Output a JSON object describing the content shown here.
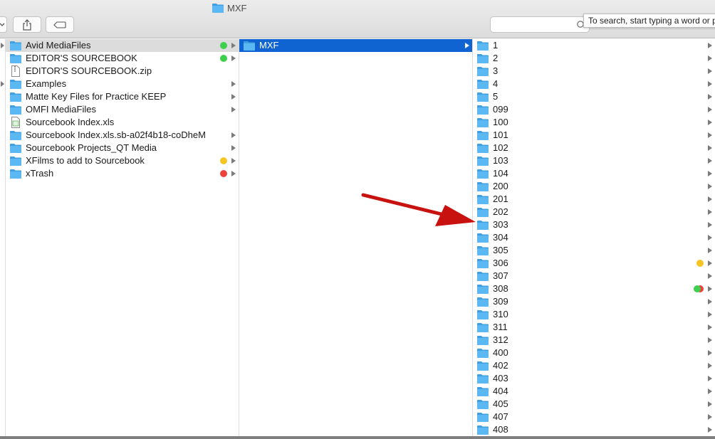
{
  "window": {
    "title": "MXF"
  },
  "toolbar": {
    "share_icon": "share-icon",
    "tag_icon": "tag-icon"
  },
  "search": {
    "placeholder": "",
    "tooltip": "To search, start typing a word or p"
  },
  "column1": {
    "items": [
      {
        "name": "Avid MediaFiles",
        "kind": "folder",
        "tag": "#3fcf4f",
        "arrow": true,
        "selected": "gray"
      },
      {
        "name": "EDITOR'S SOURCEBOOK",
        "kind": "folder",
        "tag": "#3fcf4f",
        "arrow": true
      },
      {
        "name": "EDITOR'S SOURCEBOOK.zip",
        "kind": "zip",
        "arrow": false
      },
      {
        "name": "Examples",
        "kind": "folder",
        "arrow": true
      },
      {
        "name": "Matte Key Files for Practice KEEP",
        "kind": "folder",
        "arrow": true
      },
      {
        "name": "OMFI MediaFiles",
        "kind": "folder",
        "arrow": true
      },
      {
        "name": "Sourcebook Index.xls",
        "kind": "xls",
        "arrow": false
      },
      {
        "name": "Sourcebook Index.xls.sb-a02f4b18-coDheM",
        "kind": "folder",
        "arrow": true
      },
      {
        "name": "Sourcebook Projects_QT Media",
        "kind": "folder",
        "arrow": true
      },
      {
        "name": "XFilms to add to Sourcebook",
        "kind": "folder",
        "tag": "#f5c623",
        "arrow": true
      },
      {
        "name": "xTrash",
        "kind": "folder",
        "tag": "#f0403c",
        "arrow": true
      }
    ]
  },
  "column2": {
    "items": [
      {
        "name": "MXF",
        "kind": "folder",
        "arrow": true,
        "selected": "blue"
      }
    ]
  },
  "column3": {
    "items": [
      {
        "name": "1"
      },
      {
        "name": "2"
      },
      {
        "name": "3"
      },
      {
        "name": "4"
      },
      {
        "name": "5"
      },
      {
        "name": "099"
      },
      {
        "name": "100"
      },
      {
        "name": "101"
      },
      {
        "name": "102"
      },
      {
        "name": "103"
      },
      {
        "name": "104"
      },
      {
        "name": "200"
      },
      {
        "name": "201"
      },
      {
        "name": "202"
      },
      {
        "name": "303"
      },
      {
        "name": "304"
      },
      {
        "name": "305"
      },
      {
        "name": "306",
        "tags": [
          "#f5c623"
        ]
      },
      {
        "name": "307"
      },
      {
        "name": "308",
        "tags": [
          "#f0403c",
          "#3fcf4f"
        ]
      },
      {
        "name": "309"
      },
      {
        "name": "310"
      },
      {
        "name": "311"
      },
      {
        "name": "312"
      },
      {
        "name": "400"
      },
      {
        "name": "402"
      },
      {
        "name": "403"
      },
      {
        "name": "404"
      },
      {
        "name": "405"
      },
      {
        "name": "407"
      },
      {
        "name": "408"
      }
    ]
  },
  "colors": {
    "folder_body": "#5cb8f2",
    "folder_tab": "#3f9fe0",
    "selection_blue": "#0f64d2",
    "annotation_arrow": "#c8120f"
  }
}
